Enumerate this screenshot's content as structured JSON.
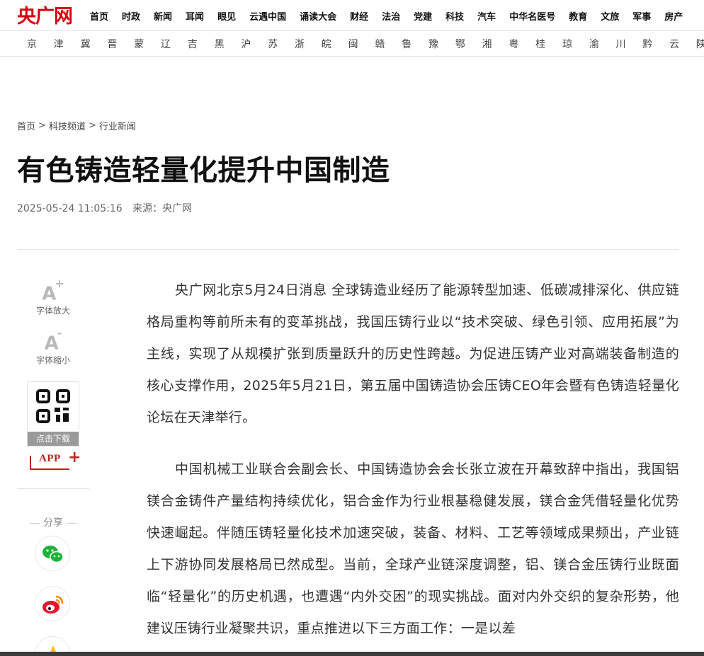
{
  "header": {
    "logo": "央广网",
    "nav": [
      "首页",
      "时政",
      "新闻",
      "耳闻",
      "眼见",
      "云遇中国",
      "诵读大会",
      "财经",
      "法治",
      "党建",
      "科技",
      "汽车",
      "中华名医号",
      "教育",
      "文旅",
      "军事",
      "房产"
    ]
  },
  "provinces": [
    "京",
    "津",
    "冀",
    "晋",
    "蒙",
    "辽",
    "吉",
    "黑",
    "沪",
    "苏",
    "浙",
    "皖",
    "闽",
    "赣",
    "鲁",
    "豫",
    "鄂",
    "湘",
    "粤",
    "桂",
    "琼",
    "渝",
    "川",
    "黔",
    "云",
    "陕"
  ],
  "breadcrumb": {
    "items": [
      "首页",
      "科技频道",
      "行业新闻"
    ],
    "separator": ">"
  },
  "article": {
    "title": "有色铸造轻量化提升中国制造",
    "datetime": "2025-05-24 11:05:16",
    "source": "来源：央广网",
    "paragraphs": [
      "央广网北京5月24日消息 全球铸造业经历了能源转型加速、低碳减排深化、供应链格局重构等前所未有的变革挑战，我国压铸行业以“技术突破、绿色引领、应用拓展”为主线，实现了从规模扩张到质量跃升的历史性跨越。为促进压铸产业对高端装备制造的核心支撑作用，2025年5月21日，第五届中国铸造协会压铸CEO年会暨有色铸造轻量化论坛在天津举行。",
      "中国机械工业联合会副会长、中国铸造协会会长张立波在开幕致辞中指出，我国铝镁合金铸件产量结构持续优化，铝合金作为行业根基稳健发展，镁合金凭借轻量化优势快速崛起。伴随压铸轻量化技术加速突破，装备、材料、工艺等领域成果频出，产业链上下游协同发展格局已然成型。当前，全球产业链深度调整，铝、镁合金压铸行业既面临“轻量化”的历史机遇，也遭遇“内外交困”的现实挑战。面对内外交织的复杂形势，他建议压铸行业凝聚共识，重点推进以下三方面工作：一是以差"
    ]
  },
  "sidebar": {
    "font_up_glyph": "A",
    "font_up_mark": "+",
    "font_up_label": "字体放大",
    "font_down_glyph": "A",
    "font_down_mark": "-",
    "font_down_label": "字体缩小",
    "qr_caption": "点击下载",
    "app_label": "APP",
    "app_plus": "+",
    "share_label": "分享"
  },
  "colors": {
    "brand_red": "#d7000f",
    "app_red": "#b1251e",
    "wechat_green": "#1fb23a",
    "weibo_red": "#e6162d",
    "qzone_yellow": "#f7c300"
  }
}
